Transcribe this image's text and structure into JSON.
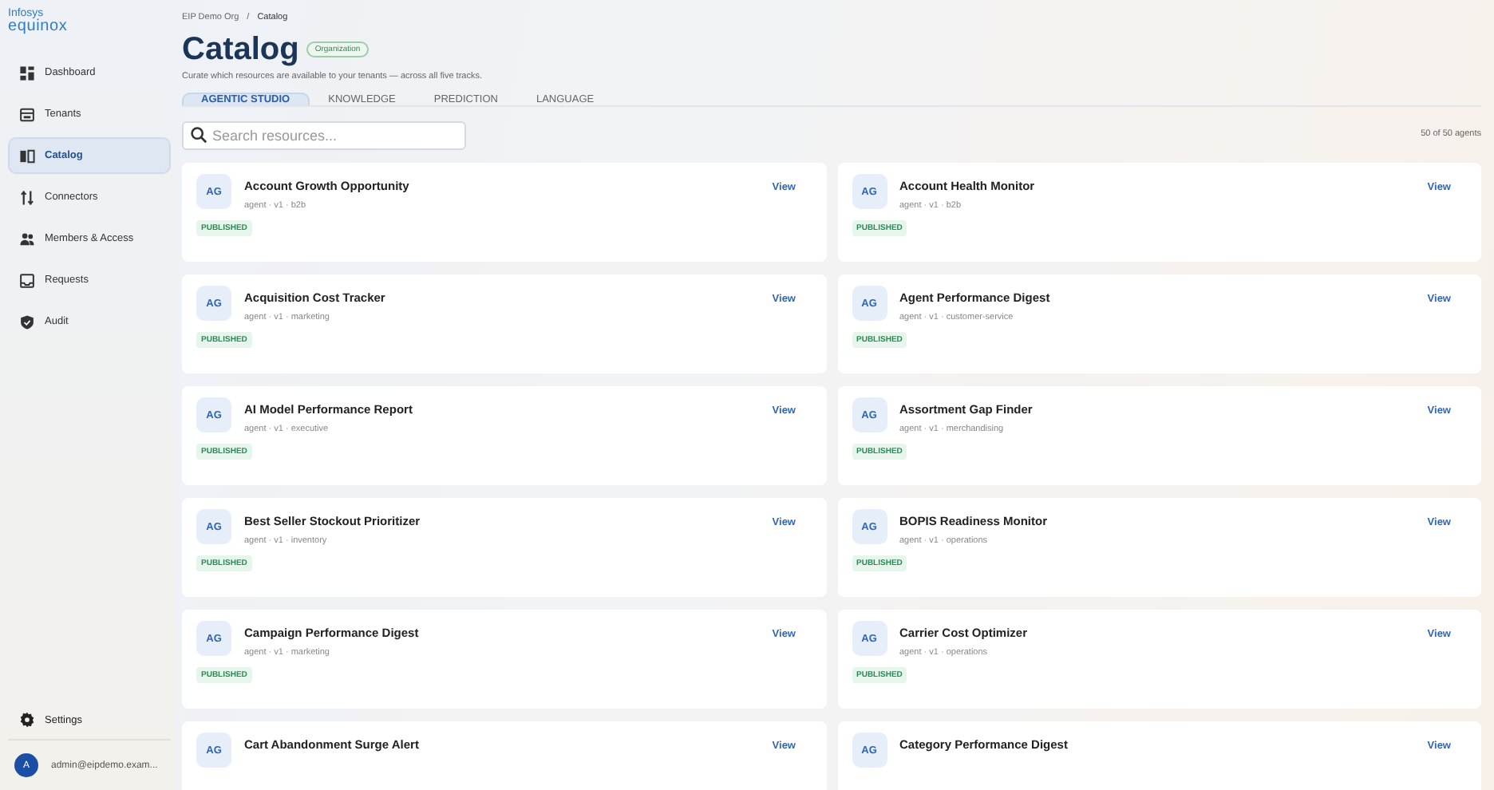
{
  "brand": {
    "line_1": "Infosys",
    "line_2": "equinox"
  },
  "sidebar": {
    "items": [
      {
        "label": "Dashboard",
        "selected": false
      },
      {
        "label": "Tenants",
        "selected": false
      },
      {
        "label": "Catalog",
        "selected": true
      },
      {
        "label": "Connectors",
        "selected": false
      },
      {
        "label": "Members & Access",
        "selected": false
      },
      {
        "label": "Requests",
        "selected": false
      },
      {
        "label": "Audit",
        "selected": false
      }
    ],
    "settings": "Settings",
    "user": {
      "initial": "A",
      "email": "admin@eipdemo.exam..."
    }
  },
  "breadcrumb": {
    "items": [
      "EIP Demo Org",
      "Catalog"
    ],
    "separator": "/"
  },
  "page": {
    "title": "Catalog",
    "badge": "Organization",
    "subtitle": "Curate which resources are available to your tenants — across all five tracks."
  },
  "tabs": [
    {
      "label": "AGENTIC STUDIO",
      "selected": true
    },
    {
      "label": "KNOWLEDGE",
      "selected": false
    },
    {
      "label": "PREDICTION",
      "selected": false
    },
    {
      "label": "LANGUAGE",
      "selected": false
    }
  ],
  "search": {
    "placeholder": "Search resources..."
  },
  "count": "50 of 50 agents",
  "cards": [
    {
      "avatar": "AG",
      "title": "Account Growth Opportunity",
      "meta": "agent · v1 · b2b",
      "status": "PUBLISHED",
      "action": "View"
    },
    {
      "avatar": "AG",
      "title": "Account Health Monitor",
      "meta": "agent · v1 · b2b",
      "status": "PUBLISHED",
      "action": "View"
    },
    {
      "avatar": "AG",
      "title": "Acquisition Cost Tracker",
      "meta": "agent · v1 · marketing",
      "status": "PUBLISHED",
      "action": "View"
    },
    {
      "avatar": "AG",
      "title": "Agent Performance Digest",
      "meta": "agent · v1 · customer-service",
      "status": "PUBLISHED",
      "action": "View"
    },
    {
      "avatar": "AG",
      "title": "AI Model Performance Report",
      "meta": "agent · v1 · executive",
      "status": "PUBLISHED",
      "action": "View"
    },
    {
      "avatar": "AG",
      "title": "Assortment Gap Finder",
      "meta": "agent · v1 · merchandising",
      "status": "PUBLISHED",
      "action": "View"
    },
    {
      "avatar": "AG",
      "title": "Best Seller Stockout Prioritizer",
      "meta": "agent · v1 · inventory",
      "status": "PUBLISHED",
      "action": "View"
    },
    {
      "avatar": "AG",
      "title": "BOPIS Readiness Monitor",
      "meta": "agent · v1 · operations",
      "status": "PUBLISHED",
      "action": "View"
    },
    {
      "avatar": "AG",
      "title": "Campaign Performance Digest",
      "meta": "agent · v1 · marketing",
      "status": "PUBLISHED",
      "action": "View"
    },
    {
      "avatar": "AG",
      "title": "Carrier Cost Optimizer",
      "meta": "agent · v1 · operations",
      "status": "PUBLISHED",
      "action": "View"
    },
    {
      "avatar": "AG",
      "title": "Cart Abandonment Surge Alert",
      "action": "View"
    },
    {
      "avatar": "AG",
      "title": "Category Performance Digest",
      "action": "View"
    }
  ]
}
